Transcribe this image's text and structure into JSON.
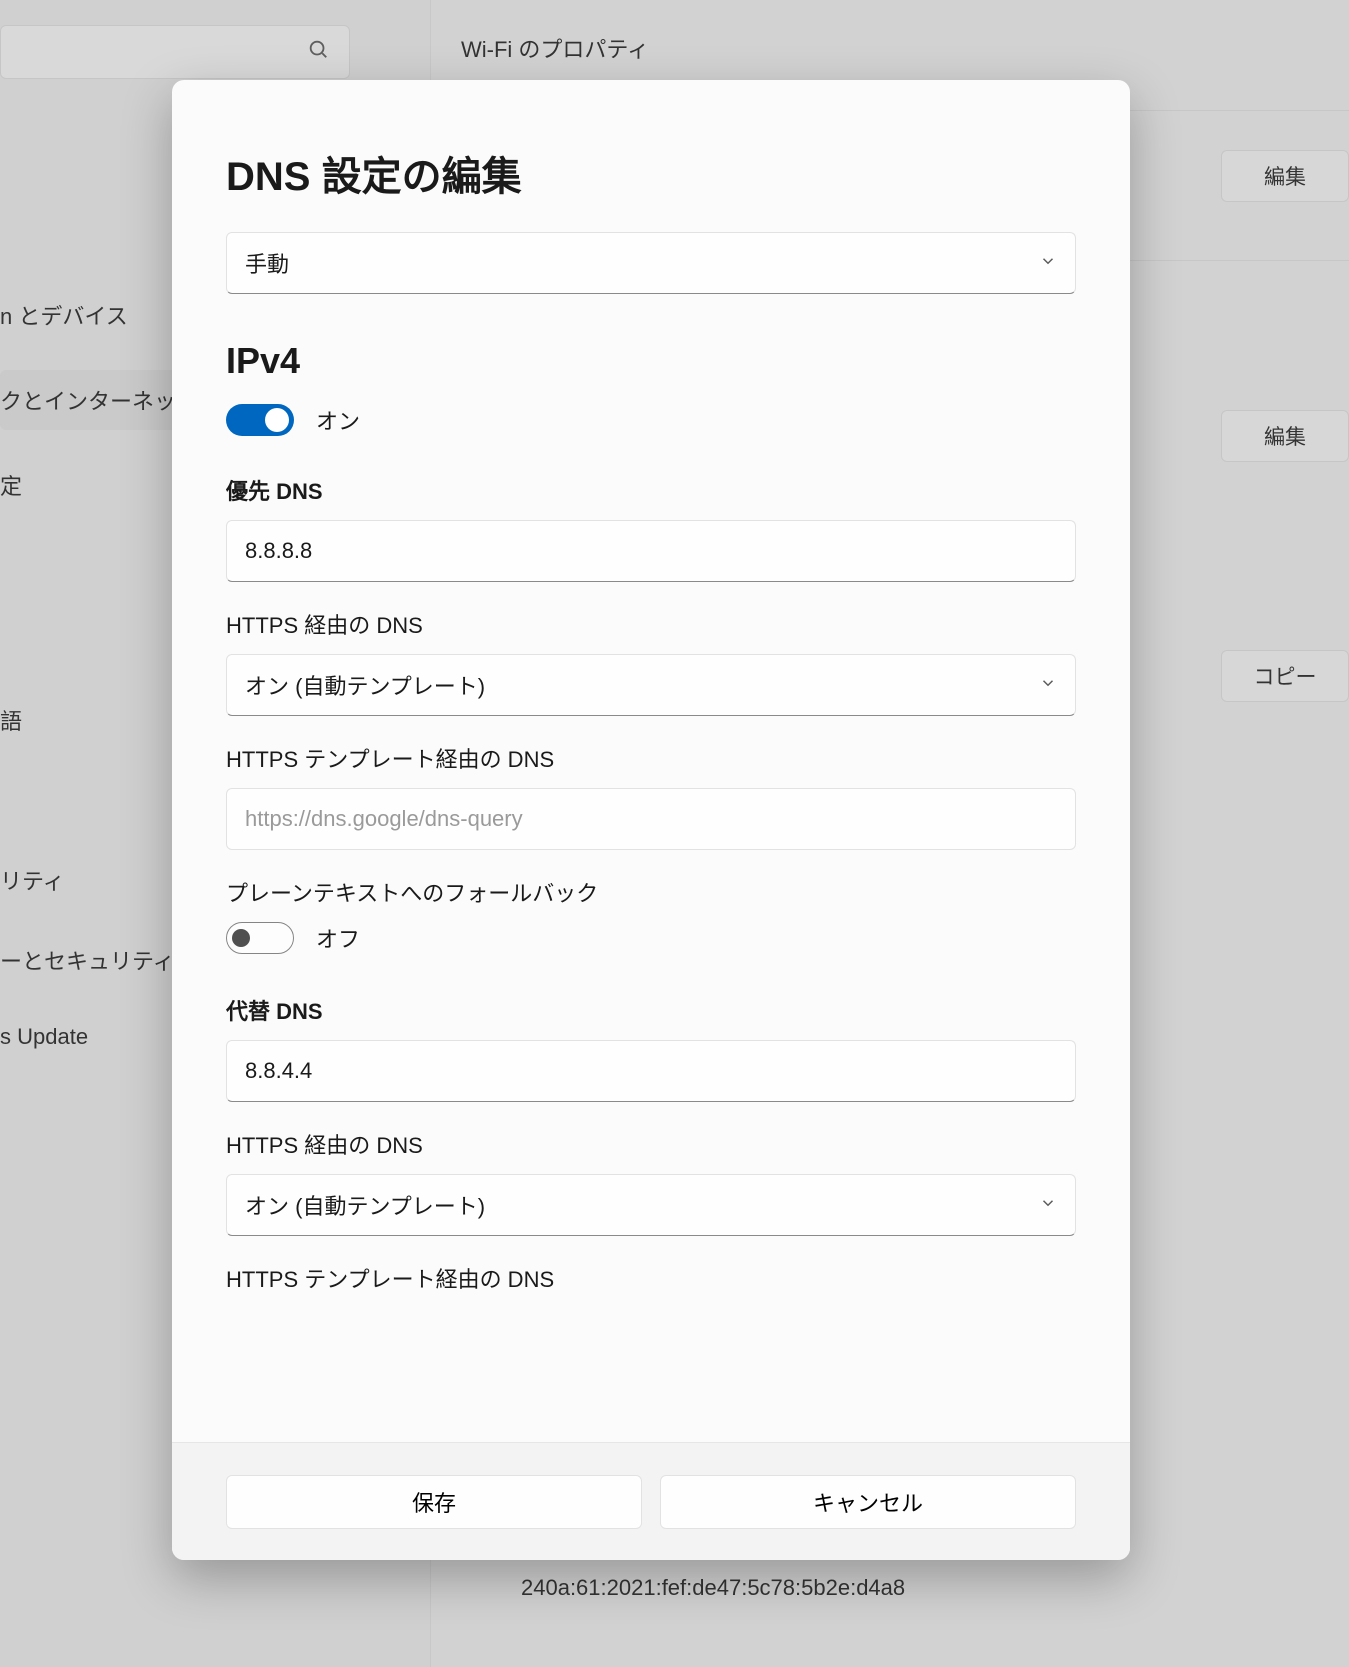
{
  "background": {
    "page_title": "Wi-Fi のプロパティ",
    "sidebar": {
      "items": [
        "n とデバイス",
        "クとインターネット",
        "定",
        "語",
        "リティ",
        "ーとセキュリティ",
        "s Update"
      ],
      "active_index": 1
    },
    "edit_button_label": "編集",
    "copy_button_label": "コピー",
    "ipv6_address": "240a:61:2021:fef:de47:5c78:5b2e:d4a8"
  },
  "dialog": {
    "title": "DNS 設定の編集",
    "mode_select": "手動",
    "ipv4": {
      "heading": "IPv4",
      "toggle_on_label": "オン",
      "preferred_label": "優先 DNS",
      "preferred_value": "8.8.8.8",
      "doh_label": "HTTPS 経由の DNS",
      "doh_value": "オン (自動テンプレート)",
      "template_label": "HTTPS テンプレート経由の DNS",
      "template_value": "https://dns.google/dns-query",
      "fallback_label": "プレーンテキストへのフォールバック",
      "fallback_off_label": "オフ",
      "alt_label": "代替 DNS",
      "alt_value": "8.8.4.4",
      "alt_doh_label": "HTTPS 経由の DNS",
      "alt_doh_value": "オン (自動テンプレート)",
      "alt_template_label": "HTTPS テンプレート経由の DNS"
    },
    "buttons": {
      "save": "保存",
      "cancel": "キャンセル"
    }
  }
}
